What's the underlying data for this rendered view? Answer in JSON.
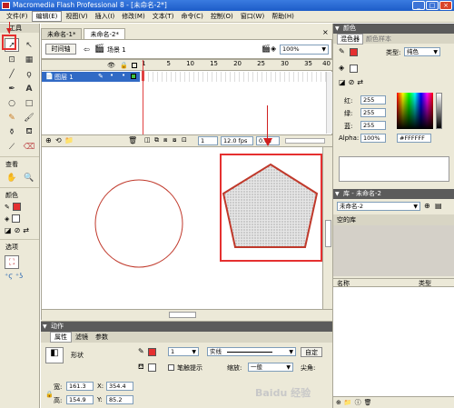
{
  "window": {
    "title": "Macromedia Flash Professional 8 - [未命名-2*]",
    "minimize": "_",
    "maximize": "□",
    "close": "×"
  },
  "menubar": [
    "文件(F)",
    "编辑(E)",
    "视图(V)",
    "插入(I)",
    "修改(M)",
    "文本(T)",
    "命令(C)",
    "控制(O)",
    "窗口(W)",
    "帮助(H)"
  ],
  "toolbox": {
    "header": "工具",
    "view_label": "查看",
    "colors_label": "颜色",
    "options_label": "选项"
  },
  "document": {
    "tabs": [
      "未命名-1*",
      "未命名-2*"
    ],
    "timeline_button": "时间轴",
    "scene": "场景 1",
    "zoom": "100%"
  },
  "timeline": {
    "layer_name": "图层 1",
    "frame_ruler": [
      "1",
      "5",
      "10",
      "15",
      "20",
      "25",
      "30",
      "35",
      "40"
    ],
    "current_frame": "1",
    "fps": "12.0 fps",
    "time": "0.0s"
  },
  "actions_panel": {
    "label": "动作"
  },
  "properties": {
    "tabs": [
      "属性",
      "滤镜",
      "参数"
    ],
    "shape_label": "形状",
    "stroke_width": "1",
    "stroke_style": "实线",
    "custom_button": "自定",
    "hinting_label": "笔触提示",
    "scale_label": "缩放:",
    "scale_value": "一般",
    "cap_label": "尖角:",
    "w_label": "宽:",
    "w_value": "161.3",
    "x_label": "X:",
    "x_value": "354.4",
    "h_label": "高:",
    "h_value": "154.9",
    "y_label": "Y:",
    "y_value": "85.2"
  },
  "color_panel": {
    "header": "颜色",
    "tabs": [
      "混色器",
      "颜色样本"
    ],
    "type_label": "类型:",
    "type_value": "纯色",
    "red_label": "红:",
    "red_value": "255",
    "green_label": "绿:",
    "green_value": "255",
    "blue_label": "蓝:",
    "blue_value": "255",
    "alpha_label": "Alpha:",
    "alpha_value": "100%",
    "hex_value": "#FFFFFF"
  },
  "library_panel": {
    "header": "库 - 未命名-2",
    "doc_select": "未命名-2",
    "empty_label": "空的库",
    "col_name": "名称",
    "col_type": "类型"
  },
  "colors": {
    "accent_red": "#e53030",
    "stroke_red": "#c0392b",
    "title_blue": "#1d5cc8",
    "panel_bg": "#ece9d8"
  },
  "watermark": "Baidu 经验"
}
